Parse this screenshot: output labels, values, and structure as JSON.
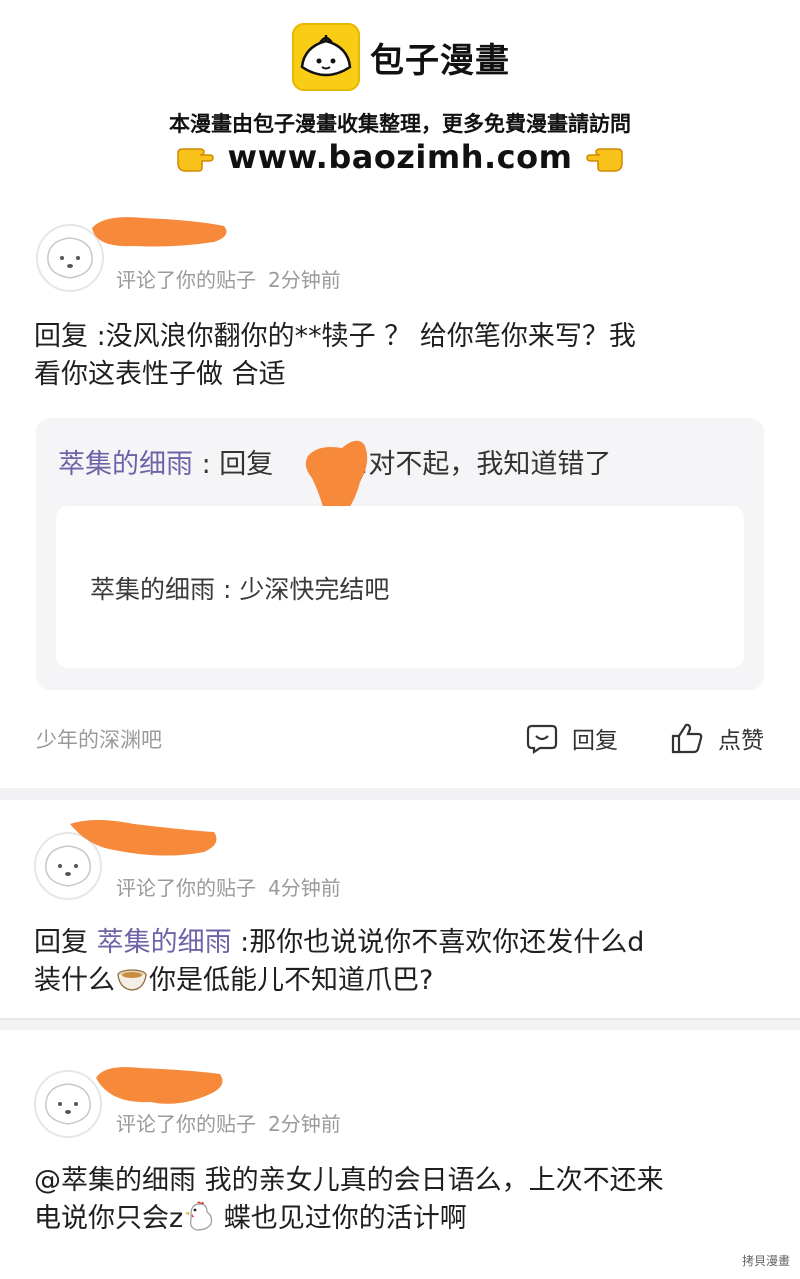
{
  "banner": {
    "title": "包子漫畫",
    "subtitle": "本漫畫由包子漫畫收集整理，更多免費漫畫請訪問",
    "url": "www.baozimh.com",
    "brand_color": "#f9cc16"
  },
  "comments": [
    {
      "meta_action": "评论了你的贴子",
      "meta_time": "2分钟前",
      "line1": "回复  :没风浪你翻你的**犊子   ？ 给你笔你来写？我",
      "line2": "看你这表性子做    合适",
      "quote": {
        "user": "萃集的细雨",
        "prefix": " : 回复",
        "text": ":对不起，我知道错了",
        "inner": "萃集的细雨 : 少深快完结吧"
      },
      "source": "少年的深渊吧",
      "reply_label": "回复",
      "like_label": "点赞"
    },
    {
      "meta_action": "评论了你的贴子",
      "meta_time": "4分钟前",
      "line1_prefix": "回复 ",
      "line1_user": "萃集的细雨",
      "line1_rest": "  :那你也说说你不喜欢你还发什么d",
      "line2_a": "装什么",
      "line2_b": "你是低能儿不知道爪巴?"
    },
    {
      "meta_action": "评论了你的贴子",
      "meta_time": "2分钟前",
      "line1": "@萃集的细雨 我的亲女儿真的会日语么，上次不还来",
      "line2_a": "电说你只会z",
      "line2_b": " 蝶也见过你的活计啊"
    }
  ],
  "watermark": "拷貝漫畫",
  "colors": {
    "redaction": "#f7893a",
    "link": "#6d64a8",
    "meta": "#9a9a9a"
  }
}
